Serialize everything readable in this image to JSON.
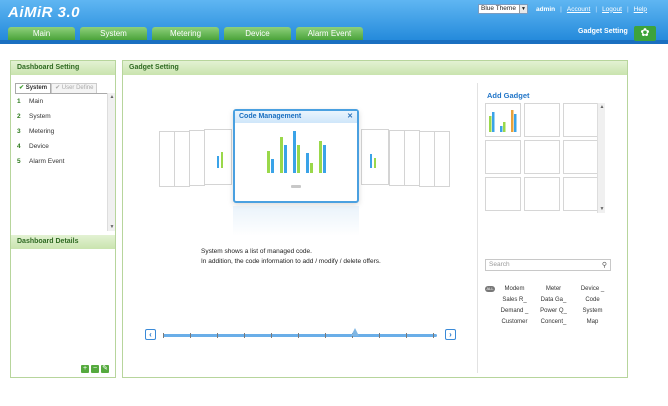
{
  "app": {
    "logo": "AiMiR 3.0",
    "theme": "Blue Theme",
    "user": "admin",
    "links": [
      "Account",
      "Logout",
      "Help"
    ]
  },
  "tabs": [
    "Main",
    "System",
    "Metering",
    "Device",
    "Alarm Event"
  ],
  "header_right": {
    "label": "Gadget Setting"
  },
  "left": {
    "title": "Dashboard Setting",
    "subtabs": [
      "System",
      "User Define"
    ],
    "items": [
      {
        "num": "1",
        "label": "Main"
      },
      {
        "num": "2",
        "label": "System"
      },
      {
        "num": "3",
        "label": "Metering"
      },
      {
        "num": "4",
        "label": "Device"
      },
      {
        "num": "5",
        "label": "Alarm Event"
      }
    ],
    "details_title": "Dashboard Details"
  },
  "main": {
    "title": "Gadget Setting",
    "focus_card_title": "Code Management",
    "description_line1": "System shows a list of managed code.",
    "description_line2": "In addition, the code information to add / modify / delete offers.",
    "add_gadget_title": "Add Gadget",
    "search_placeholder": "Search",
    "categories": {
      "badge": "ALL",
      "rows": [
        [
          "Modem",
          "Meter",
          "Device _"
        ],
        [
          "Sales R_",
          "Data Ga_",
          "Code"
        ],
        [
          "Demand _",
          "Power Q_",
          "System"
        ],
        [
          "Customer",
          "Concent_",
          "Map"
        ]
      ]
    }
  },
  "colors": {
    "header_blue": "#1f86d9",
    "tab_green": "#4ba33a",
    "panel_border": "#b7d59c",
    "chart_blue": "#3aa3e8",
    "chart_green": "#9ad84a"
  }
}
